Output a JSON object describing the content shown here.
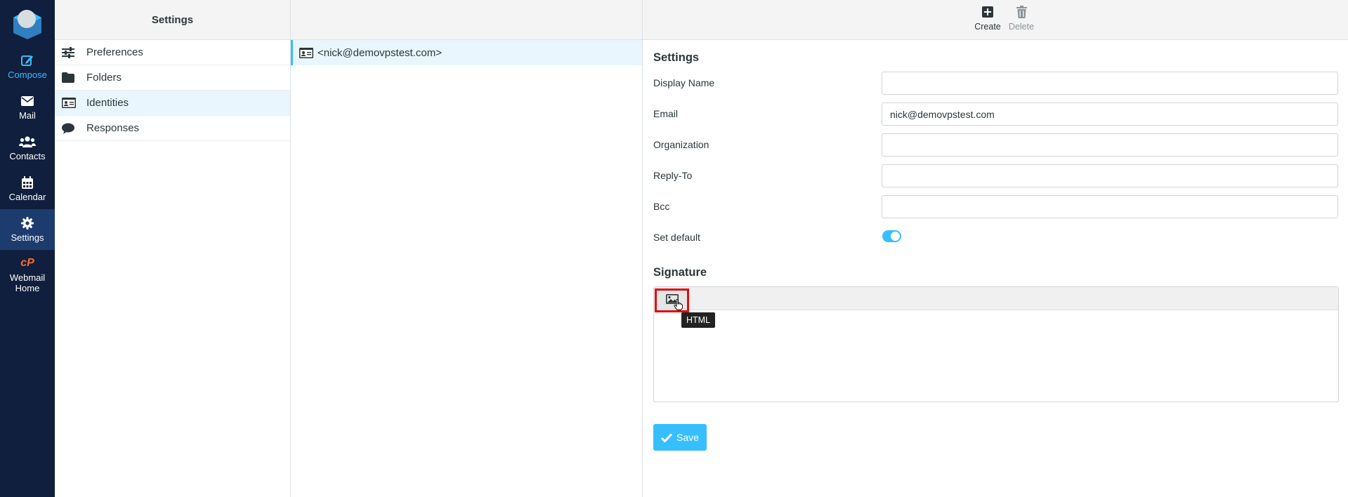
{
  "nav": {
    "items": [
      {
        "label": "Compose",
        "icon": "compose-icon"
      },
      {
        "label": "Mail",
        "icon": "mail-icon"
      },
      {
        "label": "Contacts",
        "icon": "contacts-icon"
      },
      {
        "label": "Calendar",
        "icon": "calendar-icon"
      },
      {
        "label": "Settings",
        "icon": "settings-icon"
      },
      {
        "label": "Webmail Home",
        "icon": "cpanel-icon"
      }
    ],
    "active": "Settings",
    "accent": "#37beff",
    "background": "#0f1f3d"
  },
  "settings_menu": {
    "title": "Settings",
    "items": [
      {
        "label": "Preferences",
        "icon": "sliders-icon"
      },
      {
        "label": "Folders",
        "icon": "folder-icon"
      },
      {
        "label": "Identities",
        "icon": "id-card-icon"
      },
      {
        "label": "Responses",
        "icon": "comment-icon"
      }
    ],
    "selected": "Identities"
  },
  "identities": {
    "items": [
      {
        "label": "<nick@demovpstest.com>",
        "icon": "id-card-icon"
      }
    ]
  },
  "toolbar": {
    "create_label": "Create",
    "delete_label": "Delete"
  },
  "form": {
    "section_title": "Settings",
    "display_name_label": "Display Name",
    "display_name_value": "",
    "email_label": "Email",
    "email_value": "nick@demovpstest.com",
    "organization_label": "Organization",
    "organization_value": "",
    "reply_to_label": "Reply-To",
    "reply_to_value": "",
    "bcc_label": "Bcc",
    "bcc_value": "",
    "set_default_label": "Set default",
    "set_default_on": true
  },
  "signature": {
    "title": "Signature",
    "html_button_icon": "image-icon",
    "tooltip": "HTML"
  },
  "save_label": "Save"
}
